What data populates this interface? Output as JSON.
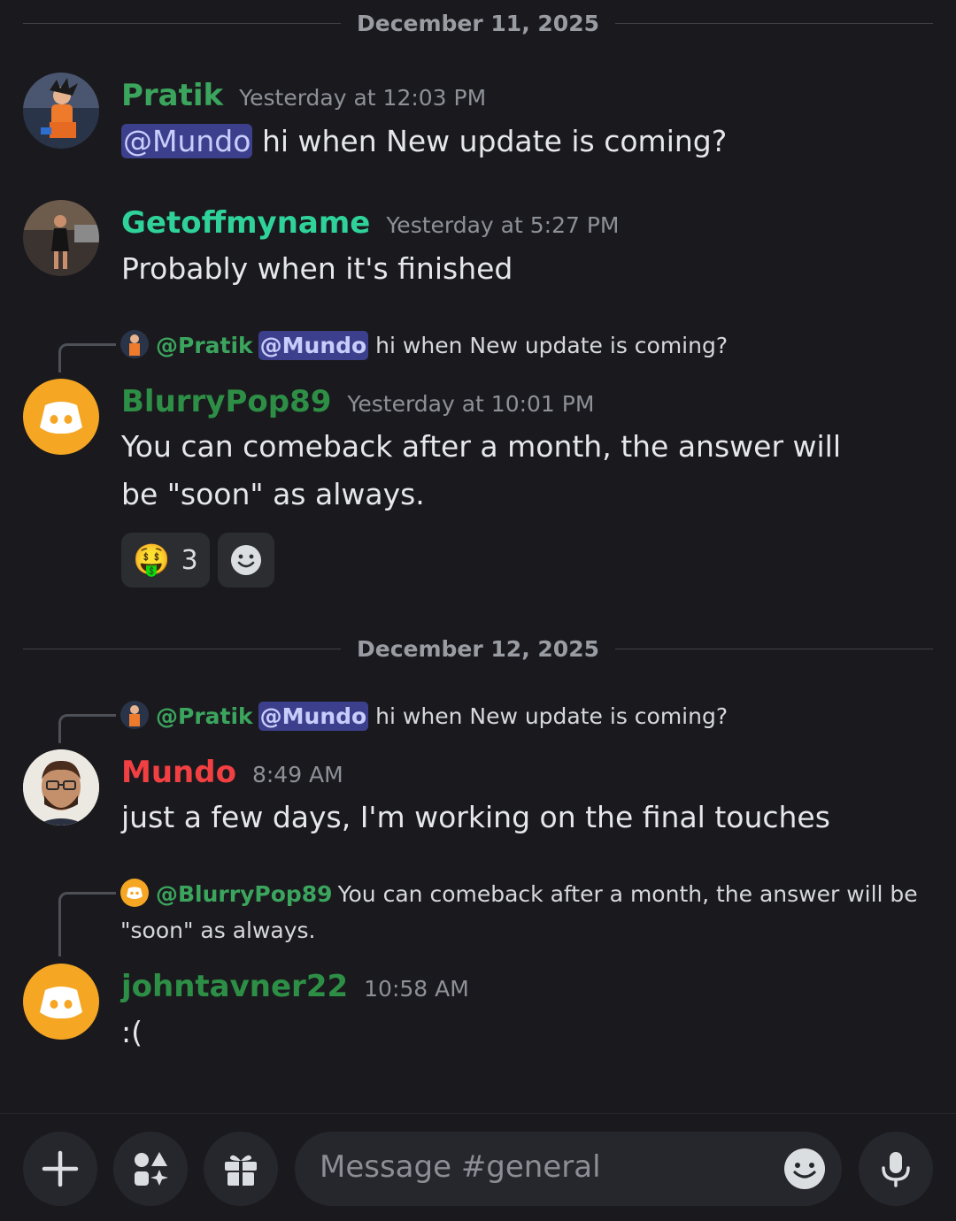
{
  "dividers": [
    "December 11, 2025",
    "December 12, 2025"
  ],
  "messages": {
    "m1": {
      "user": "Pratik",
      "color": "#3ba55d",
      "time": "Yesterday at 12:03 PM",
      "mention": "@Mundo",
      "text": " hi when New update is coming?"
    },
    "m2": {
      "user": "Getoffmyname",
      "color": "#2fd39a",
      "time": "Yesterday at 5:27 PM",
      "text": "Probably when it's finished"
    },
    "m3": {
      "reply": {
        "user": "@Pratik",
        "mention": "@Mundo",
        "text": " hi when New update is coming?"
      },
      "user": "BlurryPop89",
      "color": "#2d8f45",
      "time": "Yesterday at 10:01 PM",
      "text": "You can comeback after a month, the answer will be \"soon\" as always.",
      "reactions": [
        {
          "emoji": "🤑",
          "count": "3"
        },
        {
          "emoji": "add-reaction-icon",
          "count": ""
        }
      ]
    },
    "m4": {
      "reply": {
        "user": "@Pratik",
        "mention": "@Mundo",
        "text": " hi when New update is coming?"
      },
      "user": "Mundo",
      "color": "#f23f42",
      "time": "8:49 AM",
      "text": "just a few days, I'm working on the final touches"
    },
    "m5": {
      "reply": {
        "user": "@BlurryPop89",
        "text": "You can comeback after a month, the answer will be \"soon\" as always."
      },
      "user": "johntavner22",
      "color": "#2d8f45",
      "time": "10:58 AM",
      "text": ":("
    }
  },
  "composer": {
    "placeholder": "Message #general",
    "icons": [
      "plus-icon",
      "apps-icon",
      "gift-icon",
      "emoji-icon",
      "microphone-icon"
    ]
  },
  "colors": {
    "discord_orange": "#f5a623",
    "mention_bg": "#3c3f8c",
    "background": "#1a1a1e"
  }
}
